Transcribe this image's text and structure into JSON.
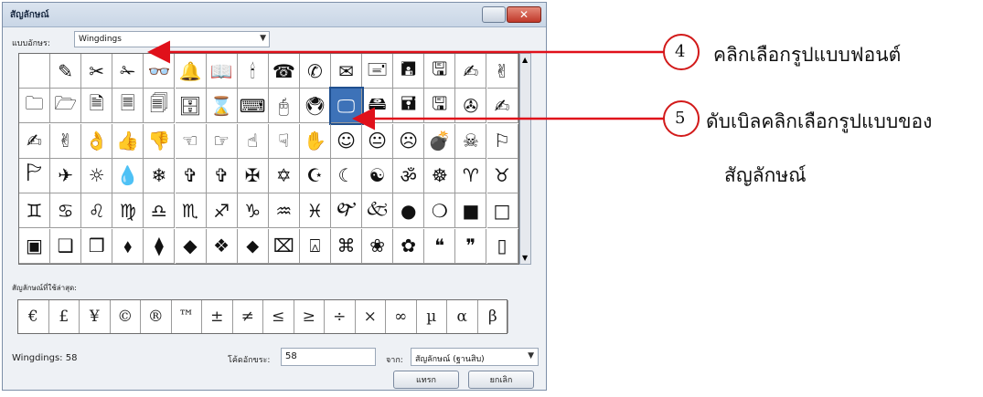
{
  "dialog": {
    "title": "สัญลักษณ์",
    "font_label": "แบบอักษร:",
    "font_value": "Wingdings",
    "recent_label": "สัญลักษณ์ที่ใช้ล่าสุด:",
    "status": "Wingdings: 58",
    "code_label": "โค้ดอักขระ:",
    "code_value": "58",
    "from_label": "จาก:",
    "from_value": "สัญลักษณ์ (ฐานสิบ)",
    "ok": "แทรก",
    "cancel": "ยกเลิก"
  },
  "symbols": [
    [
      "",
      "✎",
      "✂",
      "✁",
      "👓",
      "🔔",
      "📖",
      "🕯",
      "☎",
      "✆",
      "✉",
      "🖃",
      "🖪",
      "🖫",
      "✍",
      "✌"
    ],
    [
      "🗀",
      "🗁",
      "🗎",
      "🗏",
      "🗐",
      "🗄",
      "⌛",
      "⌨",
      "🖰",
      "🖲",
      "🖵",
      "🖴",
      "🖬",
      "🖫",
      "✇",
      "✍"
    ],
    [
      "✍",
      "✌",
      "👌",
      "👍",
      "👎",
      "☜",
      "☞",
      "☝",
      "☟",
      "✋",
      "☺",
      "😐",
      "☹",
      "💣",
      "☠",
      "⚐"
    ],
    [
      "🏱",
      "✈",
      "☼",
      "💧",
      "❄",
      "✞",
      "✞",
      "✠",
      "✡",
      "☪",
      "☾",
      "☯",
      "ॐ",
      "☸",
      "♈",
      "♉"
    ],
    [
      "♊",
      "♋",
      "♌",
      "♍",
      "♎",
      "♏",
      "♐",
      "♑",
      "♒",
      "♓",
      "🙰",
      "🙵",
      "●",
      "❍",
      "■",
      "□"
    ],
    [
      "▣",
      "❑",
      "❒",
      "⬧",
      "⧫",
      "◆",
      "❖",
      "⬥",
      "⌧",
      "⍓",
      "⌘",
      "❀",
      "✿",
      "❝",
      "❞",
      "▯"
    ]
  ],
  "recent_symbols": [
    "€",
    "£",
    "¥",
    "©",
    "®",
    "™",
    "±",
    "≠",
    "≤",
    "≥",
    "÷",
    "×",
    "∞",
    "µ",
    "α",
    "β"
  ],
  "annotations": {
    "step4_number": "4",
    "step4_text": "คลิกเลือกรูปแบบฟอนต์",
    "step5_number": "5",
    "step5_text_line1": "ดับเบิลคลิกเลือกรูปแบบของ",
    "step5_text_line2": "สัญลักษณ์"
  }
}
